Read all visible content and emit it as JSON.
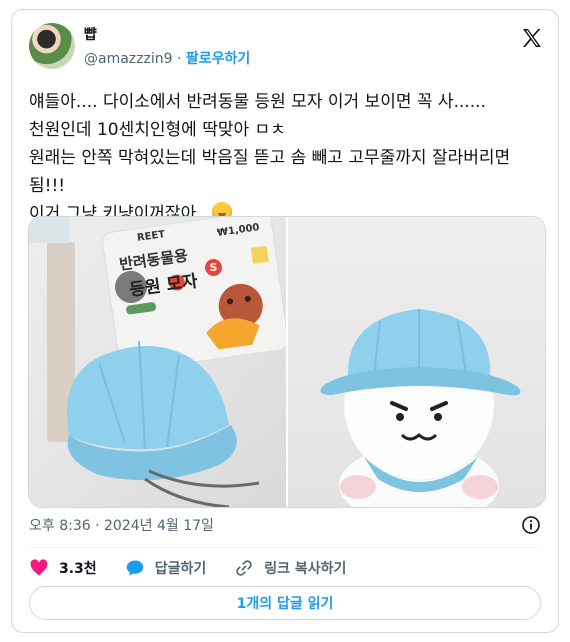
{
  "author": {
    "display_name": "뺩",
    "handle": "@amazzzin9",
    "separator": " · ",
    "follow_label": "팔로우하기"
  },
  "tweet": {
    "text": "얘들아.... 다이소에서 반려동물 등원 모자 이거 보이면 꼭 사......\n천원인데 10센치인형에 딱맞아 ㅁㅊ\n원래는 안쪽 막혀있는데 박음질 뜯고 솜 빼고 고무줄까지 잘라버리면 됨!!!\n이거 그냥 키냥이꺼잖아...",
    "emoji": "face-with-hand-over-mouth"
  },
  "media": {
    "package": {
      "brand_fragment": "REET",
      "title_line1": "반려동물용",
      "title_line2": "등원 모자",
      "size_badge": "S",
      "price": "₩1,000"
    }
  },
  "meta": {
    "timestamp": "오후 8:36 · 2024년 4월 17일"
  },
  "actions": {
    "like_count": "3.3천",
    "reply_label": "답글하기",
    "copy_link_label": "링크 복사하기"
  },
  "read_replies_label": "1개의 답글 읽기",
  "colors": {
    "link_blue": "#1d9bf0",
    "like_red": "#f91880",
    "hat_blue": "#8fd0ec",
    "muted_text": "#536471"
  },
  "icons": [
    "x-logo-icon",
    "info-icon",
    "heart-icon",
    "speech-bubble-icon",
    "link-icon"
  ]
}
